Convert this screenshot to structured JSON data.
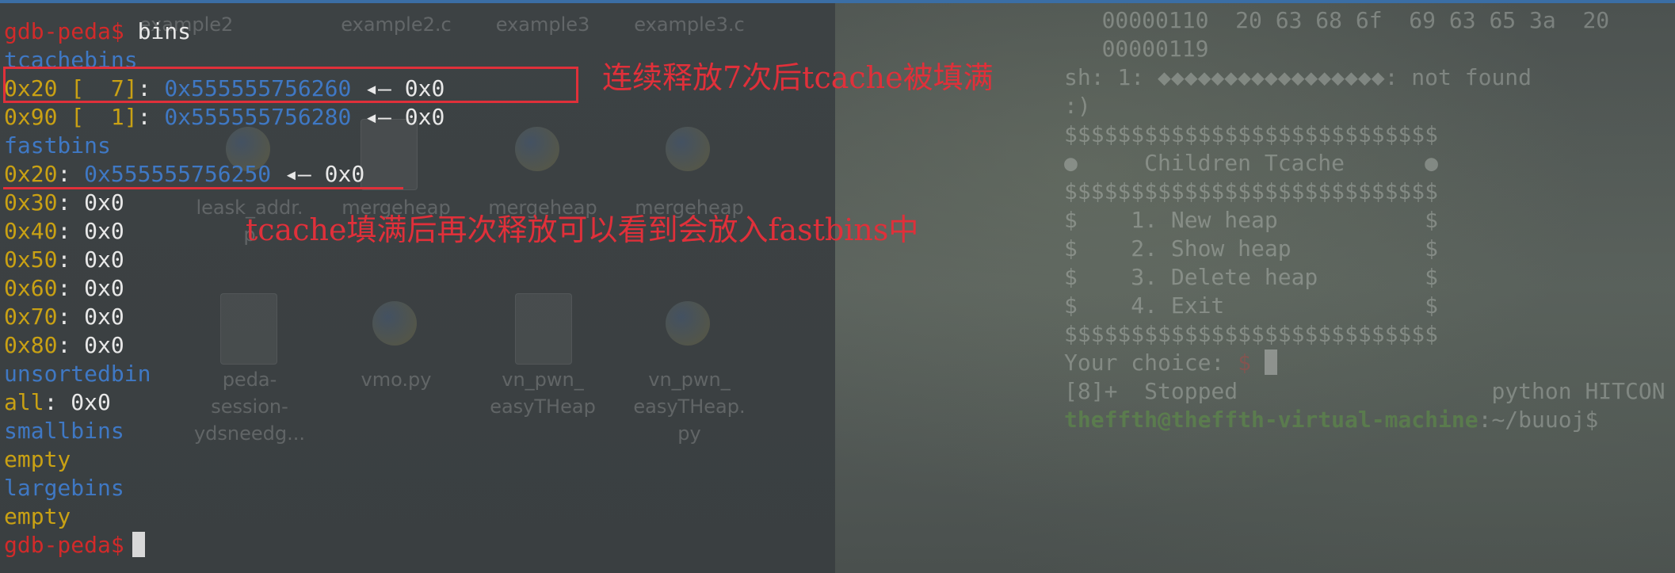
{
  "terminal": {
    "prompt": "gdb-peda$",
    "command": "bins",
    "tcache_header": "tcachebins",
    "tcache": [
      {
        "size": "0x20",
        "count": "[  7]",
        "colon": ":",
        "addr": "0x555555756260",
        "arrow": "◂—",
        "next": "0x0"
      },
      {
        "size": "0x90",
        "count": "[  1]",
        "colon": ":",
        "addr": "0x555555756280",
        "arrow": "◂—",
        "next": "0x0"
      }
    ],
    "fastbins_header": "fastbins",
    "fastbin_first": {
      "size": "0x20",
      "colon": ":",
      "addr": "0x555555756250",
      "arrow": "◂—",
      "next": "0x0"
    },
    "fastbins": [
      {
        "size": "0x30",
        "rest": ": 0x0"
      },
      {
        "size": "0x40",
        "rest": ": 0x0"
      },
      {
        "size": "0x50",
        "rest": ": 0x0"
      },
      {
        "size": "0x60",
        "rest": ": 0x0"
      },
      {
        "size": "0x70",
        "rest": ": 0x0"
      },
      {
        "size": "0x80",
        "rest": ": 0x0"
      }
    ],
    "unsorted_header": "unsortedbin",
    "unsorted_label": "all",
    "unsorted_rest": ": 0x0",
    "smallbins_header": "smallbins",
    "small_value": "empty",
    "largebins_header": "largebins",
    "large_value": "empty",
    "prompt_final": "gdb-peda$"
  },
  "annotations": {
    "tcache_note": "连续释放7次后tcache被填满",
    "fastbin_note": "tcache填满后再次释放可以看到会放入fastbins中"
  },
  "desktop": {
    "icons_top": [
      "example2",
      "example2.c",
      "example3",
      "example3.c"
    ],
    "icons_mid": [
      "leask_addr.",
      "mergeheap",
      "mergeheap",
      "mergeheap"
    ],
    "icon_mid_line2": "p",
    "icons_bottom": [
      {
        "l1": "peda-",
        "l2": "session-",
        "l3": "ydsneedg..."
      },
      {
        "l1": "vmo.py",
        "l2": "",
        "l3": ""
      },
      {
        "l1": "vn_pwn_",
        "l2": "easyTHeap",
        "l3": ""
      },
      {
        "l1": "vn_pwn_",
        "l2": "easyTHeap.",
        "l3": "py"
      }
    ]
  },
  "background_terminal": {
    "lines": [
      "   00000110  20 63 68 6f  69 63 65 3a  20",
      "   00000119",
      "sh: 1: ◆◆◆◆◆◆◆◆◆◆◆◆◆◆◆◆◆: not found",
      ":)",
      "$$$$$$$$$$$$$$$$$$$$$$$$$$$$",
      "●     Children Tcache      ●",
      "$$$$$$$$$$$$$$$$$$$$$$$$$$$$",
      "$    1. New heap           $",
      "$    2. Show heap          $",
      "$    3. Delete heap        $",
      "$    4. Exit               $",
      "$$$$$$$$$$$$$$$$$$$$$$$$$$$$"
    ],
    "choice_prompt": "Your choice: ",
    "choice_dollar": "$",
    "job_line": "[8]+  Stopped                   python HITCON",
    "user_host": "theffth@theffth-virtual-machine",
    "cwd": ":~/buuoj$"
  },
  "colors": {
    "prompt": "#d22a2a",
    "address": "#3f78c4",
    "size": "#c9a114",
    "annotation": "#e0303a"
  }
}
